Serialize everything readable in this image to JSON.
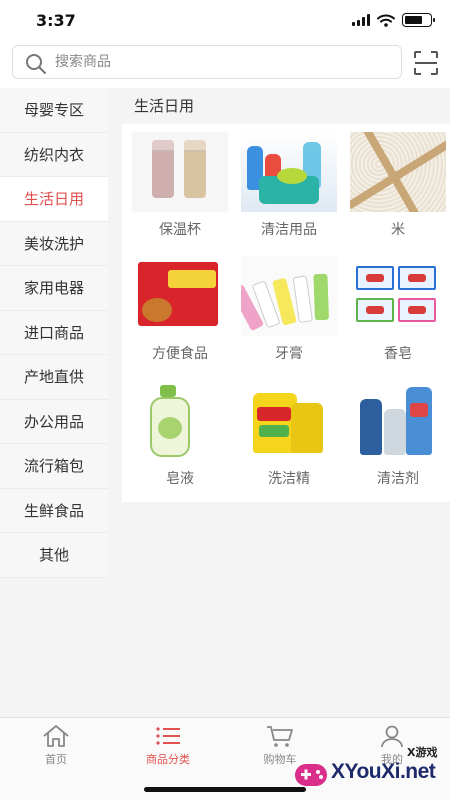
{
  "status_bar": {
    "time": "3:37"
  },
  "search": {
    "placeholder": "搜索商品"
  },
  "sidebar": {
    "items": [
      {
        "label": "母婴专区"
      },
      {
        "label": "纺织内衣"
      },
      {
        "label": "生活日用",
        "active": true
      },
      {
        "label": "美妆洗护"
      },
      {
        "label": "家用电器"
      },
      {
        "label": "进口商品"
      },
      {
        "label": "产地直供"
      },
      {
        "label": "办公用品"
      },
      {
        "label": "流行箱包"
      },
      {
        "label": "生鲜食品"
      },
      {
        "label": "其他"
      }
    ]
  },
  "content": {
    "title": "生活日用",
    "products": [
      {
        "label": "保温杯",
        "icon": "thermos-cup-image"
      },
      {
        "label": "清洁用品",
        "icon": "cleaning-supplies-image"
      },
      {
        "label": "米",
        "icon": "rice-image"
      },
      {
        "label": "方便食品",
        "icon": "instant-noodles-image"
      },
      {
        "label": "牙膏",
        "icon": "toothpaste-image"
      },
      {
        "label": "香皂",
        "icon": "soap-bar-image"
      },
      {
        "label": "皂液",
        "icon": "liquid-soap-image"
      },
      {
        "label": "洗洁精",
        "icon": "dish-soap-image"
      },
      {
        "label": "清洁剂",
        "icon": "detergent-image"
      }
    ]
  },
  "tabbar": {
    "tabs": [
      {
        "label": "首页",
        "icon": "home-icon"
      },
      {
        "label": "商品分类",
        "icon": "list-icon",
        "active": true
      },
      {
        "label": "购物车",
        "icon": "cart-icon"
      },
      {
        "label": "我的",
        "icon": "user-icon"
      }
    ]
  },
  "watermark": {
    "text": "XYouXi.net",
    "tag": "X游戏"
  },
  "colors": {
    "accent": "#e0504f",
    "text": "#333333",
    "muted": "#666666",
    "background": "#f4f4f4"
  }
}
